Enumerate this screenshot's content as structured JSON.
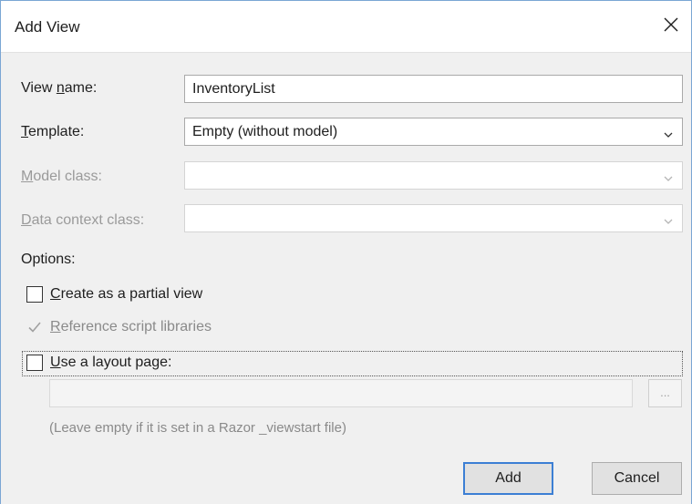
{
  "dialog": {
    "title": "Add View",
    "close_icon": "close-icon"
  },
  "form": {
    "view_name": {
      "label_accel": "View ",
      "label_u": "n",
      "label_rest": "ame:",
      "value": "InventoryList"
    },
    "template": {
      "label_u": "T",
      "label_rest": "emplate:",
      "value": "Empty (without model)"
    },
    "model_class": {
      "label_u": "M",
      "label_rest": "odel class:",
      "value": ""
    },
    "data_context": {
      "label_u": "D",
      "label_rest": "ata context class:",
      "value": ""
    }
  },
  "options": {
    "heading": "Options:",
    "partial_view": {
      "u": "C",
      "rest": "reate as a partial view",
      "checked": false
    },
    "reference_scripts": {
      "u": "R",
      "rest": "eference script libraries",
      "checked": true,
      "disabled": true
    },
    "layout_page": {
      "u": "U",
      "rest": "se a layout page:",
      "checked": false
    },
    "layout_path": "",
    "browse_label": "...",
    "hint": "(Leave empty if it is set in a Razor _viewstart file)"
  },
  "buttons": {
    "add": "Add",
    "cancel": "Cancel"
  },
  "colors": {
    "accent": "#3c7fd4",
    "disabled_text": "#9a9a9a"
  }
}
